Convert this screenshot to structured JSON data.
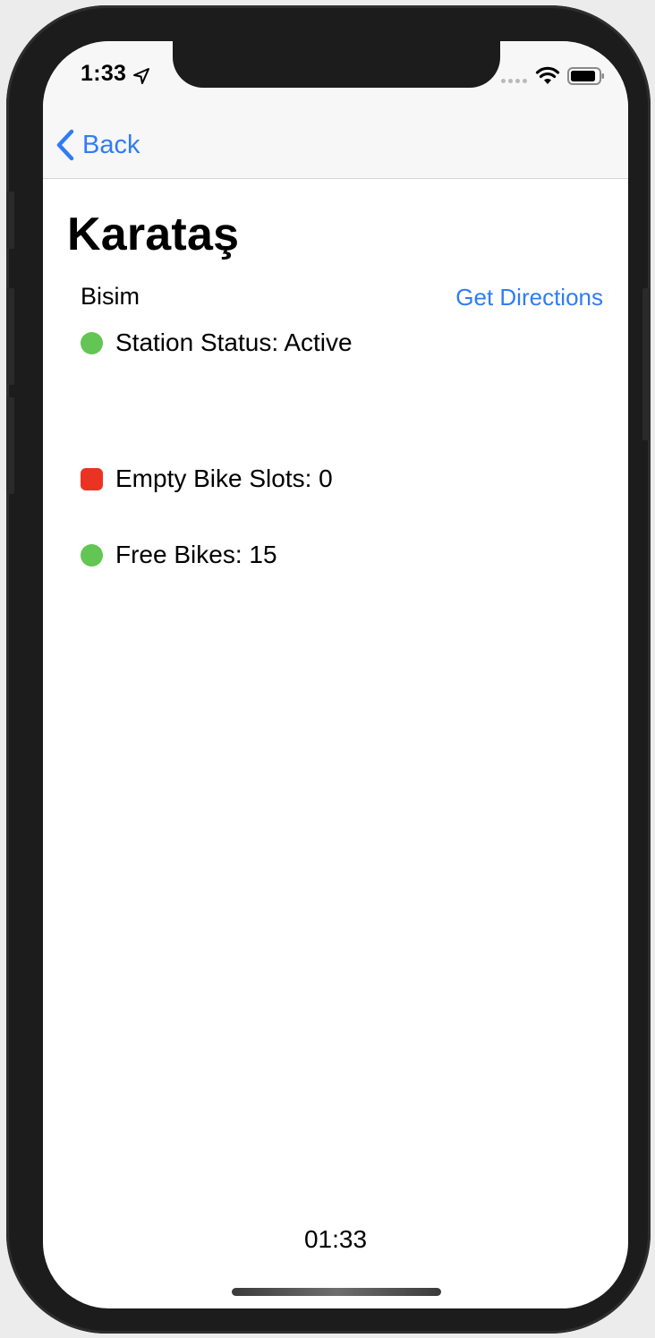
{
  "status_bar": {
    "time": "1:33",
    "location_icon": "location-arrow-icon",
    "signal_icon": "signal-dots-icon",
    "wifi_icon": "wifi-icon",
    "battery_icon": "battery-icon"
  },
  "nav": {
    "back_label": "Back",
    "back_icon": "chevron-left-icon"
  },
  "station": {
    "name": "Karataş",
    "network": "Bisim",
    "directions_label": "Get Directions"
  },
  "rows": [
    {
      "label": "Station Status: Active",
      "indicator": "green"
    },
    {
      "label": "Empty Bike Slots: 0",
      "indicator": "red"
    },
    {
      "label": "Free Bikes: 15",
      "indicator": "green"
    }
  ],
  "footer": {
    "time": "01:33"
  },
  "colors": {
    "accent": "#2f7cf6",
    "green": "#62c554",
    "red": "#ea3323",
    "bezel": "#1c1c1c",
    "navbar_bg": "#f7f7f7"
  }
}
